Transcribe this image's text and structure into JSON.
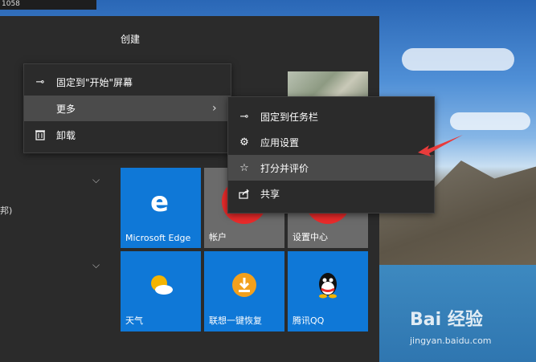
{
  "window": {
    "title_fragment": "1058"
  },
  "start_menu": {
    "group_title": "创建",
    "left_label": "邦)",
    "tiles": [
      {
        "label": "Microsoft Edge",
        "icon": "edge-icon",
        "color": "#0f78d7"
      },
      {
        "label": "帐户",
        "icon": "account-icon",
        "color": "#6b6b6b"
      },
      {
        "label": "设置中心",
        "icon": "settings-center-icon",
        "color": "#6b6b6b"
      },
      {
        "label": "天气",
        "icon": "weather-icon",
        "color": "#0f78d7"
      },
      {
        "label": "联想一键恢复",
        "icon": "recovery-icon",
        "color": "#0f78d7"
      },
      {
        "label": "腾讯QQ",
        "icon": "qq-icon",
        "color": "#0f78d7"
      }
    ]
  },
  "context_menu": {
    "items": [
      {
        "label": "固定到\"开始\"屏幕",
        "icon": "pin-icon"
      },
      {
        "label": "更多",
        "icon": ""
      },
      {
        "label": "卸载",
        "icon": "trash-icon"
      }
    ]
  },
  "submenu": {
    "items": [
      {
        "label": "固定到任务栏",
        "icon": "pin-icon"
      },
      {
        "label": "应用设置",
        "icon": "gear-icon"
      },
      {
        "label": "打分并评价",
        "icon": "star-icon"
      },
      {
        "label": "共享",
        "icon": "share-icon"
      }
    ]
  },
  "watermark": {
    "brand": "Bai 经验",
    "url": "jingyan.baidu.com"
  },
  "colors": {
    "accent": "#0f78d7",
    "menu_bg": "#2b2b2b",
    "highlight": "#4b4b4b",
    "arrow": "#e83b3b"
  }
}
